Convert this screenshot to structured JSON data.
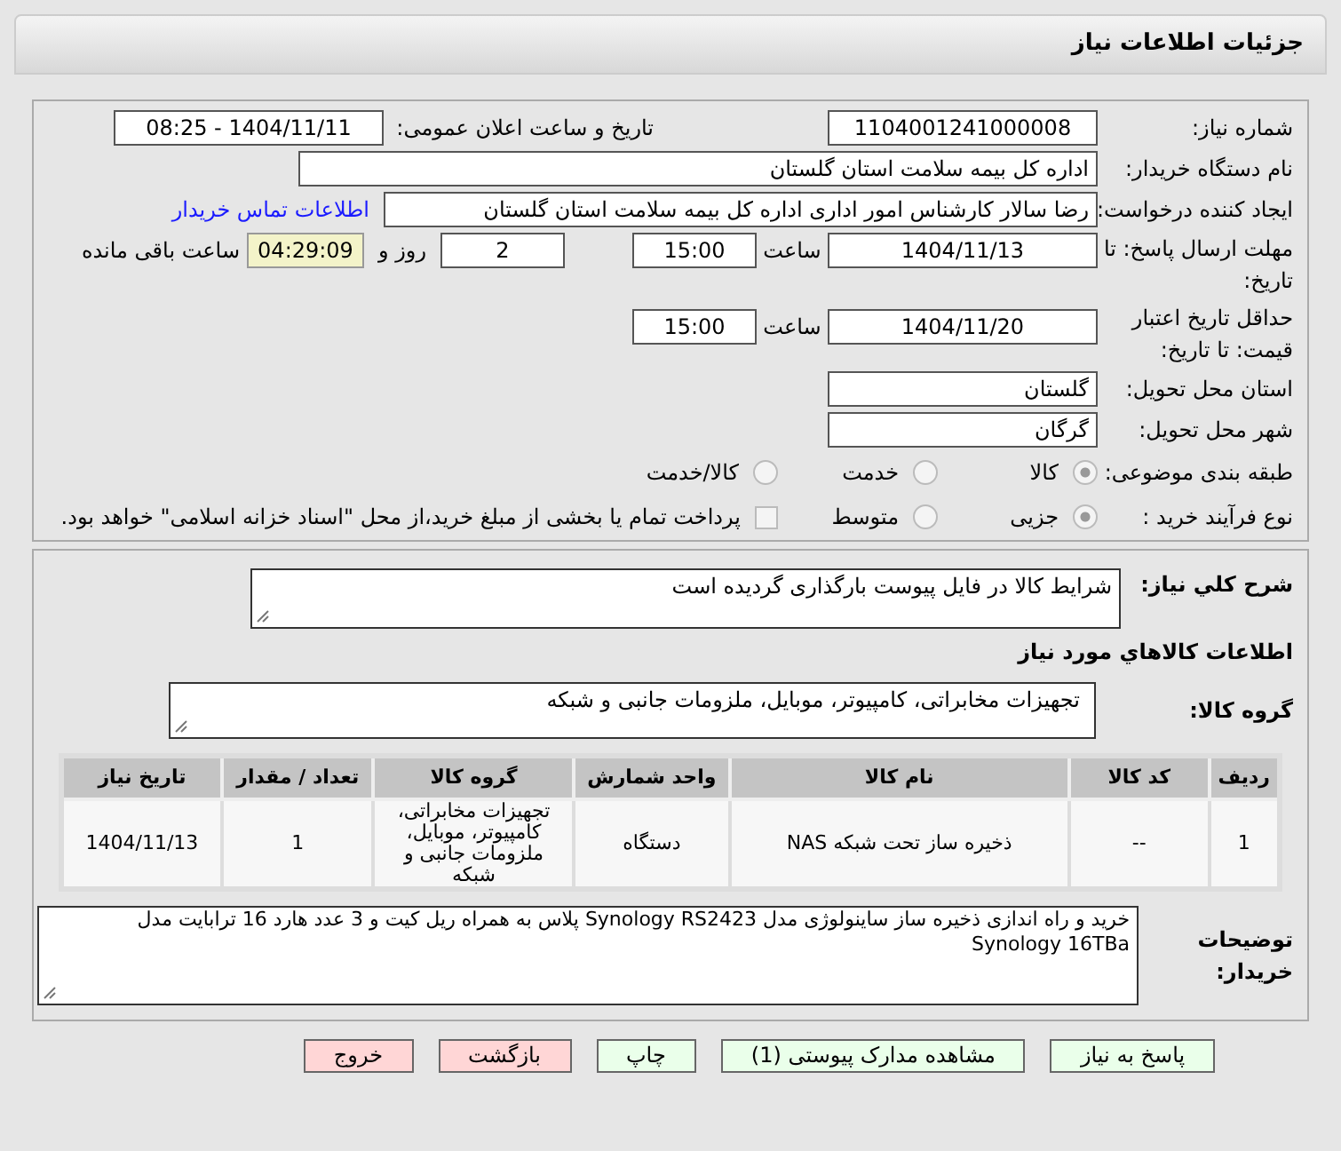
{
  "header": {
    "title": "جزئیات اطلاعات نیاز"
  },
  "need_number": {
    "label": "شماره نیاز:",
    "value": "1104001241000008"
  },
  "announce": {
    "label": "تاریخ و ساعت اعلان عمومی:",
    "value": "1404/11/11 - 08:25"
  },
  "buyer_org": {
    "label": "نام دستگاه خریدار:",
    "value": "اداره کل بیمه سلامت استان گلستان"
  },
  "requester": {
    "label": "ایجاد کننده درخواست:",
    "value": "رضا سالار کارشناس امور اداری اداره کل بیمه سلامت استان گلستان",
    "link": "اطلاعات تماس خریدار"
  },
  "reply_deadline": {
    "label": "مهلت ارسال پاسخ: تا تاریخ:",
    "date": "1404/11/13",
    "time_label": "ساعت",
    "time": "15:00",
    "days": "2",
    "days_label": "روز و",
    "remaining": "04:29:09",
    "remaining_label": "ساعت باقی مانده"
  },
  "price_validity": {
    "label": "حداقل تاریخ اعتبار قیمت: تا تاریخ:",
    "date": "1404/11/20",
    "time_label": "ساعت",
    "time": "15:00"
  },
  "province": {
    "label": "استان محل تحویل:",
    "value": "گلستان"
  },
  "city": {
    "label": "شهر محل تحویل:",
    "value": "گرگان"
  },
  "category": {
    "label": "طبقه بندی موضوعی:",
    "options": [
      {
        "label": "کالا",
        "selected": true
      },
      {
        "label": "خدمت",
        "selected": false
      },
      {
        "label": "کالا/خدمت",
        "selected": false
      }
    ]
  },
  "process": {
    "label": "نوع فرآیند خرید :",
    "options": [
      {
        "label": "جزیی",
        "selected": true
      },
      {
        "label": "متوسط",
        "selected": false
      }
    ],
    "checkbox": {
      "label": "پرداخت تمام یا بخشی از مبلغ خرید،از محل \"اسناد خزانه اسلامی\" خواهد بود.",
      "checked": false
    }
  },
  "description": {
    "label": "شرح کلي نياز:",
    "value": "شرایط کالا در فایل پیوست بارگذاری گردیده است"
  },
  "goods_title": "اطلاعات کالاهاي مورد نياز",
  "goods_group": {
    "label": "گروه کالا:",
    "value": "تجهیزات مخابراتی، کامپیوتر، موبایل، ملزومات جانبی و شبکه"
  },
  "table": {
    "columns": [
      "ردیف",
      "کد کالا",
      "نام کالا",
      "واحد شمارش",
      "گروه کالا",
      "تعداد / مقدار",
      "تاریخ نیاز"
    ],
    "rows": [
      [
        "1",
        "--",
        "ذخیره ساز تحت شبکه NAS",
        "دستگاه",
        "تجهیزات مخابراتی، کامپیوتر، موبایل، ملزومات جانبی و شبکه",
        "1",
        "1404/11/13"
      ]
    ]
  },
  "buyer_notes": {
    "label": "توضیحات خریدار:",
    "value": "خرید و راه اندازی ذخیره ساز ساینولوژی مدل Synology RS2423 پلاس به همراه ریل کیت و 3 عدد هارد 16 ترابایت مدل Synology 16TBa"
  },
  "buttons": [
    {
      "label": "پاسخ به نیاز",
      "kind": "normal"
    },
    {
      "label": "مشاهده مدارک پیوستی (1)",
      "kind": "normal"
    },
    {
      "label": "چاپ",
      "kind": "normal"
    },
    {
      "label": "بازگشت",
      "kind": "danger"
    },
    {
      "label": "خروج",
      "kind": "danger"
    }
  ]
}
